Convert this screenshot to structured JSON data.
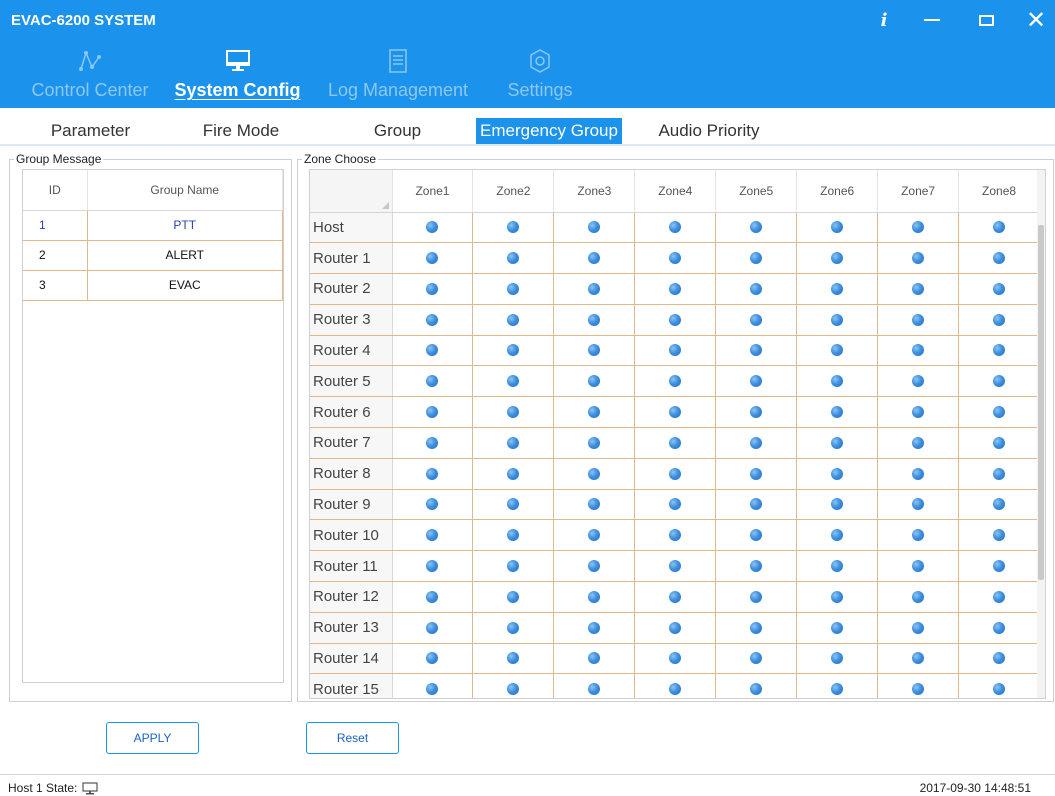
{
  "window": {
    "title": "EVAC-6200 SYSTEM",
    "info_label": "i",
    "minimize_label": "—",
    "close_label": "✕"
  },
  "nav": [
    {
      "id": "control-center",
      "label": "Control Center",
      "icon": "network-icon",
      "active": false
    },
    {
      "id": "system-config",
      "label": "System Config",
      "icon": "monitor-icon",
      "active": true
    },
    {
      "id": "log-management",
      "label": "Log Management",
      "icon": "document-icon",
      "active": false
    },
    {
      "id": "settings",
      "label": "Settings",
      "icon": "gear-icon",
      "active": false
    }
  ],
  "subtabs": [
    {
      "id": "parameter",
      "label": "Parameter",
      "active": false
    },
    {
      "id": "fire-mode",
      "label": "Fire Mode",
      "active": false
    },
    {
      "id": "group",
      "label": "Group",
      "active": false
    },
    {
      "id": "emergency-group",
      "label": "Emergency Group",
      "active": true
    },
    {
      "id": "audio-priority",
      "label": "Audio Priority",
      "active": false
    }
  ],
  "group_message": {
    "legend": "Group Message",
    "columns": {
      "id": "ID",
      "name": "Group Name"
    },
    "rows": [
      {
        "id": "1",
        "name": "PTT",
        "selected": true
      },
      {
        "id": "2",
        "name": "ALERT",
        "selected": false
      },
      {
        "id": "3",
        "name": "EVAC",
        "selected": false
      }
    ]
  },
  "zone_choose": {
    "legend": "Zone Choose",
    "columns": [
      "Zone1",
      "Zone2",
      "Zone3",
      "Zone4",
      "Zone5",
      "Zone6",
      "Zone7",
      "Zone8"
    ],
    "rows": [
      "Host",
      "Router 1",
      "Router 2",
      "Router 3",
      "Router 4",
      "Router 5",
      "Router 6",
      "Router 7",
      "Router 8",
      "Router 9",
      "Router 10",
      "Router 11",
      "Router 12",
      "Router 13",
      "Router 14",
      "Router 15"
    ]
  },
  "buttons": {
    "apply": "APPLY",
    "reset": "Reset"
  },
  "status": {
    "host_state_label": "Host 1 State:",
    "host_state_icon": "monitor-icon",
    "datetime": "2017-09-30 14:48:51"
  },
  "colors": {
    "accent": "#1b92ec",
    "inactive_nav": "#8cc8f5",
    "grid_line": "#e0b98a",
    "selected_text": "#2b42b4"
  }
}
